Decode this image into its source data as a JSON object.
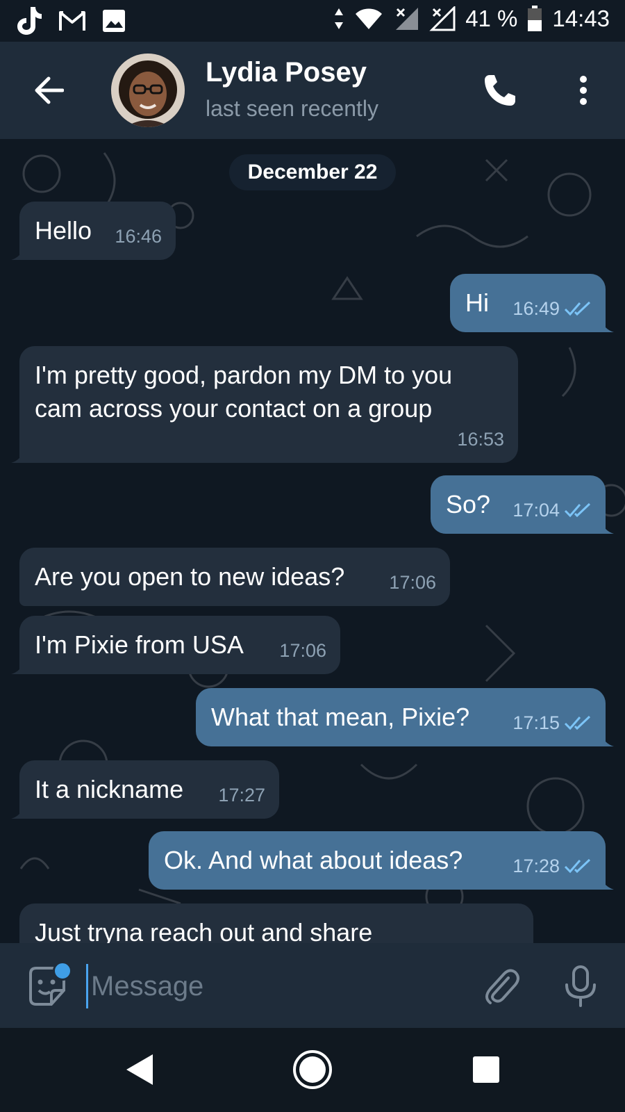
{
  "status_bar": {
    "battery": "41 %",
    "time": "14:43",
    "left_icons": [
      "tiktok-icon",
      "gmail-icon",
      "gallery-icon"
    ],
    "right_icons": [
      "data-arrows-icon",
      "wifi-icon",
      "signal-x-icon",
      "signal-x-icon",
      "battery-icon"
    ]
  },
  "header": {
    "back_icon": "arrow-left-icon",
    "contact_name": "Lydia Posey",
    "contact_status": "last seen recently",
    "call_icon": "phone-icon",
    "menu_icon": "more-vertical-icon"
  },
  "chat": {
    "date_chip": "December 22",
    "messages": [
      {
        "dir": "in",
        "text": "Hello",
        "time": "16:46"
      },
      {
        "dir": "out",
        "text": "Hi",
        "time": "16:49",
        "read": true
      },
      {
        "dir": "in",
        "text_lines": [
          "I'm pretty good, pardon my DM to you",
          "cam across your contact on a group"
        ],
        "time": "16:53"
      },
      {
        "dir": "out",
        "text": "So?",
        "time": "17:04",
        "read": true
      },
      {
        "dir": "in",
        "text": "Are you open to new ideas?",
        "time": "17:06"
      },
      {
        "dir": "in",
        "text": "I'm Pixie from USA",
        "time": "17:06"
      },
      {
        "dir": "out",
        "text": "What that mean, Pixie?",
        "time": "17:15",
        "read": true
      },
      {
        "dir": "in",
        "text": "It a nickname",
        "time": "17:27"
      },
      {
        "dir": "out",
        "text": "Ok. And what about ideas?",
        "time": "17:28",
        "read": true
      },
      {
        "dir": "in",
        "text": "Just tryna reach out and share",
        "time": "",
        "partial": true
      }
    ]
  },
  "input_bar": {
    "placeholder": "Message",
    "value": "",
    "emoji_icon": "sticker-smile-icon",
    "attach_icon": "paperclip-icon",
    "mic_icon": "microphone-icon"
  },
  "nav_bar": {
    "icons": [
      "nav-back-icon",
      "nav-home-icon",
      "nav-recents-icon"
    ]
  },
  "colors": {
    "background": "#0e1621",
    "header": "#1f2c3a",
    "incoming_bubble": "#232f3d",
    "outgoing_bubble": "#467196",
    "accent": "#4aa4ef"
  }
}
